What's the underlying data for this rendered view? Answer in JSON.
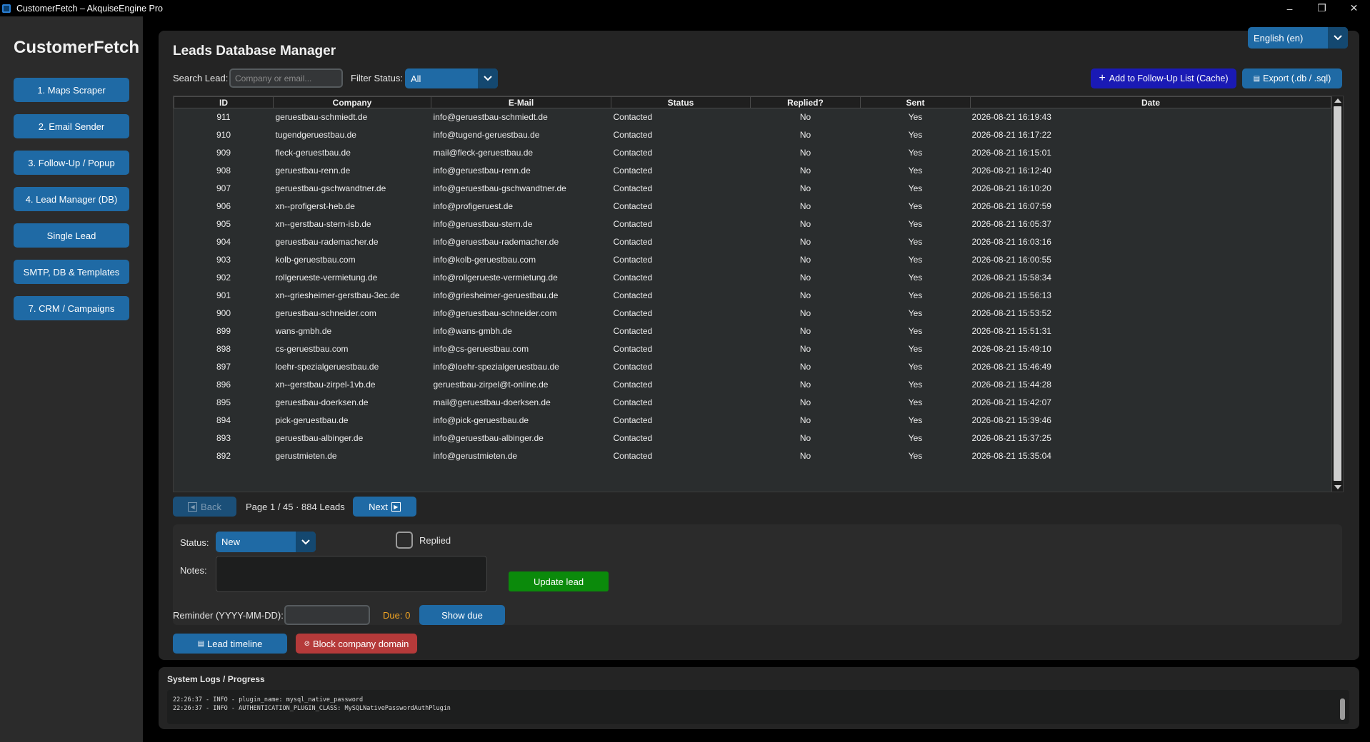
{
  "window": {
    "title": "CustomerFetch – AkquiseEngine Pro",
    "controls": [
      "–",
      "❐",
      "✕"
    ]
  },
  "sidebar": {
    "brand": "CustomerFetch",
    "items": [
      {
        "label": "1. Maps Scraper"
      },
      {
        "label": "2. Email Sender"
      },
      {
        "label": "3. Follow-Up / Popup"
      },
      {
        "label": "4. Lead Manager (DB)"
      },
      {
        "label": "Single Lead"
      },
      {
        "label": "SMTP, DB & Templates"
      },
      {
        "label": "7. CRM / Campaigns"
      }
    ]
  },
  "main": {
    "title": "Leads Database Manager",
    "language": "English (en)",
    "search_label": "Search Lead:",
    "search_placeholder": "Company or email...",
    "filter_label": "Filter Status:",
    "filter_value": "All",
    "followup_button": "Add to Follow-Up List (Cache)",
    "export_button": "Export (.db / .sql)"
  },
  "table": {
    "columns": [
      "ID",
      "Company",
      "E-Mail",
      "Status",
      "Replied?",
      "Sent",
      "Date"
    ],
    "rows": [
      [
        "911",
        "geruestbau-schmiedt.de",
        "info@geruestbau-schmiedt.de",
        "Contacted",
        "No",
        "Yes",
        "2026-08-21 16:19:43"
      ],
      [
        "910",
        "tugendgeruestbau.de",
        "info@tugend-geruestbau.de",
        "Contacted",
        "No",
        "Yes",
        "2026-08-21 16:17:22"
      ],
      [
        "909",
        "fleck-geruestbau.de",
        "mail@fleck-geruestbau.de",
        "Contacted",
        "No",
        "Yes",
        "2026-08-21 16:15:01"
      ],
      [
        "908",
        "geruestbau-renn.de",
        "info@geruestbau-renn.de",
        "Contacted",
        "No",
        "Yes",
        "2026-08-21 16:12:40"
      ],
      [
        "907",
        "geruestbau-gschwandtner.de",
        "info@geruestbau-gschwandtner.de",
        "Contacted",
        "No",
        "Yes",
        "2026-08-21 16:10:20"
      ],
      [
        "906",
        "xn--profigerst-heb.de",
        "info@profigeruest.de",
        "Contacted",
        "No",
        "Yes",
        "2026-08-21 16:07:59"
      ],
      [
        "905",
        "xn--gerstbau-stern-isb.de",
        "info@geruestbau-stern.de",
        "Contacted",
        "No",
        "Yes",
        "2026-08-21 16:05:37"
      ],
      [
        "904",
        "geruestbau-rademacher.de",
        "info@geruestbau-rademacher.de",
        "Contacted",
        "No",
        "Yes",
        "2026-08-21 16:03:16"
      ],
      [
        "903",
        "kolb-geruestbau.com",
        "info@kolb-geruestbau.com",
        "Contacted",
        "No",
        "Yes",
        "2026-08-21 16:00:55"
      ],
      [
        "902",
        "rollgerueste-vermietung.de",
        "info@rollgerueste-vermietung.de",
        "Contacted",
        "No",
        "Yes",
        "2026-08-21 15:58:34"
      ],
      [
        "901",
        "xn--griesheimer-gerstbau-3ec.de",
        "info@griesheimer-geruestbau.de",
        "Contacted",
        "No",
        "Yes",
        "2026-08-21 15:56:13"
      ],
      [
        "900",
        "geruestbau-schneider.com",
        "info@geruestbau-schneider.com",
        "Contacted",
        "No",
        "Yes",
        "2026-08-21 15:53:52"
      ],
      [
        "899",
        "wans-gmbh.de",
        "info@wans-gmbh.de",
        "Contacted",
        "No",
        "Yes",
        "2026-08-21 15:51:31"
      ],
      [
        "898",
        "cs-geruestbau.com",
        "info@cs-geruestbau.com",
        "Contacted",
        "No",
        "Yes",
        "2026-08-21 15:49:10"
      ],
      [
        "897",
        "loehr-spezialgeruestbau.de",
        "info@loehr-spezialgeruestbau.de",
        "Contacted",
        "No",
        "Yes",
        "2026-08-21 15:46:49"
      ],
      [
        "896",
        "xn--gerstbau-zirpel-1vb.de",
        "geruestbau-zirpel@t-online.de",
        "Contacted",
        "No",
        "Yes",
        "2026-08-21 15:44:28"
      ],
      [
        "895",
        "geruestbau-doerksen.de",
        "mail@geruestbau-doerksen.de",
        "Contacted",
        "No",
        "Yes",
        "2026-08-21 15:42:07"
      ],
      [
        "894",
        "pick-geruestbau.de",
        "info@pick-geruestbau.de",
        "Contacted",
        "No",
        "Yes",
        "2026-08-21 15:39:46"
      ],
      [
        "893",
        "geruestbau-albinger.de",
        "info@geruestbau-albinger.de",
        "Contacted",
        "No",
        "Yes",
        "2026-08-21 15:37:25"
      ],
      [
        "892",
        "gerustmieten.de",
        "info@gerustmieten.de",
        "Contacted",
        "No",
        "Yes",
        "2026-08-21 15:35:04"
      ]
    ]
  },
  "pagination": {
    "back_label": "Back",
    "page_info": "Page 1 / 45  ·  884 Leads",
    "next_label": "Next"
  },
  "edit": {
    "status_label": "Status:",
    "status_value": "New",
    "replied_label": "Replied",
    "notes_label": "Notes:",
    "update_button": "Update lead"
  },
  "reminder": {
    "label": "Reminder (YYYY-MM-DD):",
    "due": "Due: 0",
    "show_due_button": "Show due",
    "timeline_button": "Lead timeline",
    "block_button": "Block company domain"
  },
  "logs": {
    "title": "System Logs / Progress",
    "lines": [
      "22:26:37 - INFO - plugin_name: mysql_native_password",
      "22:26:37 - INFO - AUTHENTICATION_PLUGIN_CLASS: MySQLNativePasswordAuthPlugin"
    ]
  },
  "colors": {
    "accent": "#1f6aa5",
    "followup": "#1a1ab5",
    "update": "#0b8a0b",
    "danger": "#b53a3a",
    "due": "#f5a623"
  }
}
